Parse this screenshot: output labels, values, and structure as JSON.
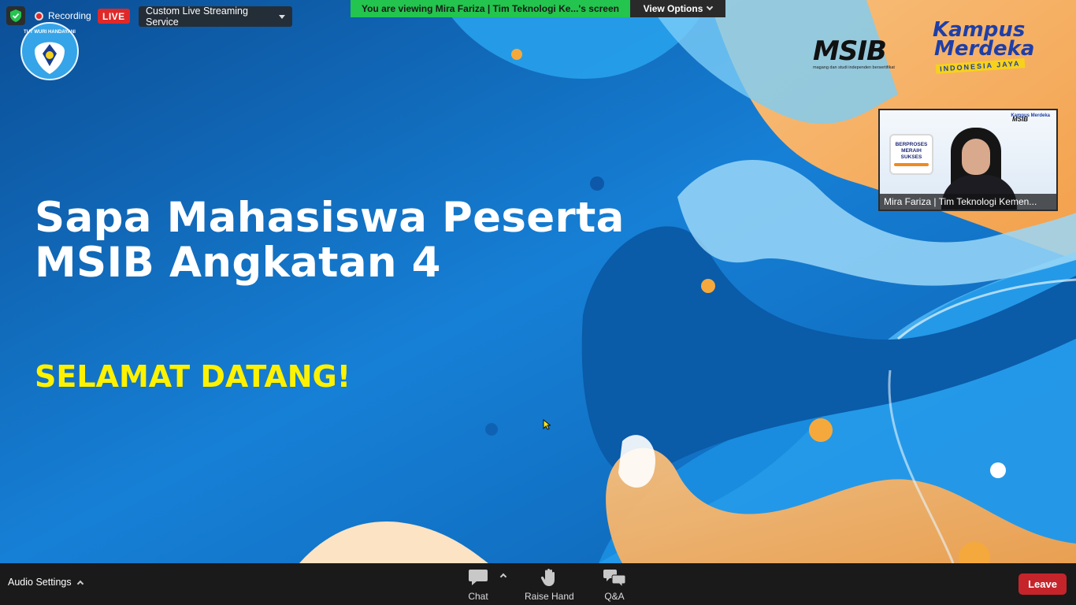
{
  "slide": {
    "title_line1": "Sapa Mahasiswa Peserta",
    "title_line2": "MSIB Angkatan 4",
    "subtitle": "SELAMAT DATANG!",
    "logo_tut_wuri": "TUT WURI HANDAYANI",
    "logo_msib": "MSIB",
    "logo_msib_tagline": "magang dan studi independen bersertifikat",
    "logo_km_line1": "Kampus",
    "logo_km_line2": "Merdeka",
    "logo_km_line3": "INDONESIA JAYA"
  },
  "meeting": {
    "recording_label": "Recording",
    "live_label": "LIVE",
    "stream_service_label": "Custom Live Streaming Service",
    "viewing_banner": "You are viewing Mira Fariza | Tim Teknologi Ke...'s screen",
    "view_options_label": "View Options"
  },
  "video": {
    "participant_name": "Mira Fariza | Tim Teknologi Kemen...",
    "badge_line1": "BERPROSES",
    "badge_line2": "MERAIH",
    "badge_line3": "SUKSES",
    "small_msib": "MSIB",
    "small_km": "Kampus Merdeka"
  },
  "toolbar": {
    "audio_settings_label": "Audio Settings",
    "chat_label": "Chat",
    "raise_hand_label": "Raise Hand",
    "qa_label": "Q&A",
    "leave_label": "Leave"
  },
  "colors": {
    "slide_blue": "#1277c9",
    "accent_orange": "#f5a94a",
    "title_white": "#ffffff",
    "subtitle_yellow": "#fff200",
    "viewing_green": "#23c54e",
    "live_red": "#e02828",
    "leave_red": "#c5242b",
    "toolbar_bg": "#1a1a1a"
  },
  "icons": {
    "shield": "shield-check-icon",
    "chat": "chat-bubble-icon",
    "raise_hand": "hand-icon",
    "qa": "qa-bubbles-icon"
  }
}
